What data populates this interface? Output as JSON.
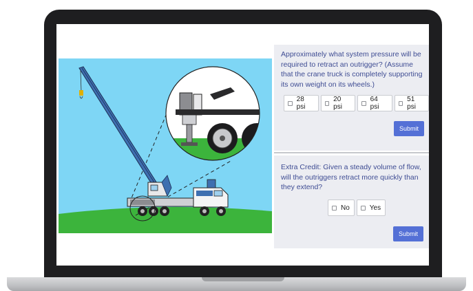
{
  "illustration": {
    "description_icon": "crane-truck-outrigger-illustration",
    "sky_color": "#7ed6f5",
    "ground_color": "#3cb43c",
    "crane_color": "#3e6fb0"
  },
  "question1": {
    "prompt": "Approximately what system pressure will be required to retract an outrigger? (Assume that the crane truck is completely supporting its own weight on its wheels.)",
    "options": [
      "28 psi",
      "20 psi",
      "64 psi",
      "51 psi"
    ],
    "submit_label": "Submit"
  },
  "question2": {
    "prompt": "Extra Credit: Given a steady volume of flow, will the outriggers retract more quickly than they extend?",
    "options": [
      "No",
      "Yes"
    ],
    "submit_label": "Submit"
  },
  "theme": {
    "accent": "#5470d6",
    "question_text": "#3e4c93",
    "panel_bg": "#ecedf2"
  }
}
